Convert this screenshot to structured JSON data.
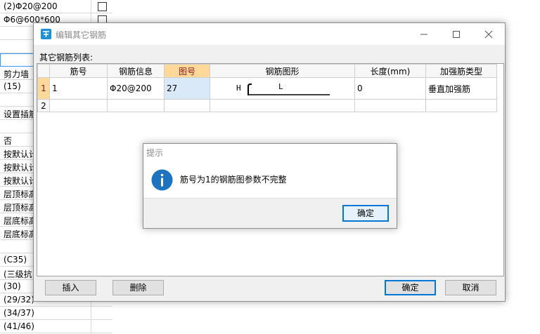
{
  "background_grid": {
    "rows": [
      {
        "text": "(2)Φ20@200",
        "checkbox": true
      },
      {
        "text": "Φ6@600*600",
        "checkbox": true
      },
      {
        "text": "",
        "checkbox": false
      },
      {
        "text": "",
        "checkbox": false
      },
      {
        "text": "",
        "checkbox": false,
        "selected": true
      },
      {
        "text": "剪力墙",
        "checkbox": false
      },
      {
        "text": "(15)",
        "checkbox": false
      },
      {
        "text": "",
        "checkbox": false
      },
      {
        "text": "设置插筋",
        "checkbox": false
      },
      {
        "text": "",
        "checkbox": false
      },
      {
        "text": "否",
        "checkbox": false
      },
      {
        "text": "按默认计",
        "checkbox": false
      },
      {
        "text": "按默认计",
        "checkbox": false
      },
      {
        "text": "按默认计",
        "checkbox": false
      },
      {
        "text": "层顶标高",
        "checkbox": false
      },
      {
        "text": "层顶标高",
        "checkbox": false
      },
      {
        "text": "层底标高",
        "checkbox": false
      },
      {
        "text": "层底标高",
        "checkbox": false
      },
      {
        "text": "",
        "checkbox": false
      },
      {
        "text": "(C35)",
        "checkbox": false
      },
      {
        "text": "(三级抗",
        "checkbox": false
      },
      {
        "text": "(30)",
        "checkbox": false
      },
      {
        "text": "(29/32)",
        "checkbox": false
      },
      {
        "text": "(34/37)",
        "checkbox": false
      },
      {
        "text": "(41/46)",
        "checkbox": false
      }
    ]
  },
  "window": {
    "title": "编辑其它钢筋",
    "list_label": "其它钢筋列表:",
    "table": {
      "headers": [
        "",
        "筋号",
        "钢筋信息",
        "图号",
        "钢筋图形",
        "长度(mm)",
        "加强筋类型"
      ],
      "highlighted_header": "图号",
      "rows": [
        {
          "num": "1",
          "name": "1",
          "info": "Φ20@200",
          "figure_no": "27",
          "shape_h": "H",
          "shape_l": "L",
          "length": "0",
          "type": "垂直加强筋"
        },
        {
          "num": "2",
          "name": "",
          "info": "",
          "figure_no": "",
          "shape_h": "",
          "shape_l": "",
          "length": "",
          "type": ""
        }
      ]
    },
    "buttons": {
      "insert": "插入",
      "delete": "删除",
      "ok": "确定",
      "cancel": "取消"
    }
  },
  "message_box": {
    "title": "提示",
    "message": "筋号为1的钢筋图参数不完整",
    "ok": "确定"
  },
  "colors": {
    "accent": "#0078d7",
    "header_highlight": "#ffd89a",
    "cell_highlight": "#d9e9f7",
    "info_icon": "#1e73be"
  },
  "icons": {
    "app": "rebar-app-icon",
    "info": "info-icon",
    "minimize": "minimize-icon",
    "maximize": "maximize-icon",
    "close": "close-icon"
  }
}
